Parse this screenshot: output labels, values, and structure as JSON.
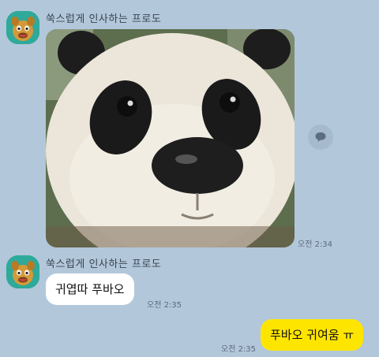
{
  "chat": {
    "messages": [
      {
        "sender": "쑥스럽게 인사하는 프로도",
        "type": "image",
        "image_subject": "panda close-up",
        "time": "오전 2:34"
      },
      {
        "sender": "쑥스럽게 인사하는 프로도",
        "type": "text",
        "text": "귀엽따 푸바오",
        "time": "오전 2:35"
      },
      {
        "type": "text",
        "mine": true,
        "text": "푸바오 귀여움 ㅠ",
        "time": "오전 2:35"
      }
    ]
  },
  "colors": {
    "background": "#b2c7da",
    "incoming_bubble": "#ffffff",
    "outgoing_bubble": "#fee500",
    "avatar_bg": "#2fa99a"
  },
  "icons": {
    "share": "speech-bubble-icon",
    "avatar": "frodo-character-icon"
  }
}
